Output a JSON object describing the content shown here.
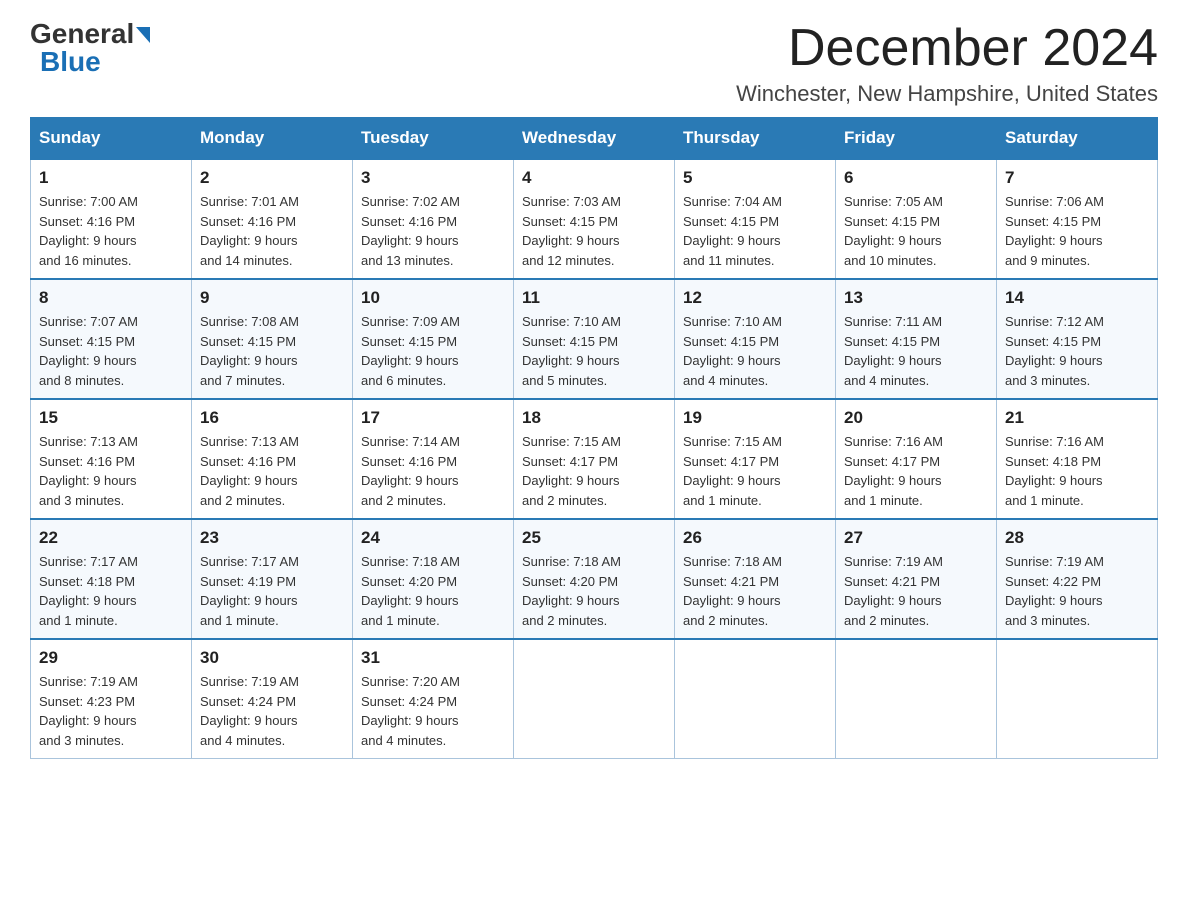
{
  "header": {
    "logo_general": "General",
    "logo_blue": "Blue",
    "month_title": "December 2024",
    "location": "Winchester, New Hampshire, United States"
  },
  "days_of_week": [
    "Sunday",
    "Monday",
    "Tuesday",
    "Wednesday",
    "Thursday",
    "Friday",
    "Saturday"
  ],
  "weeks": [
    [
      {
        "day": "1",
        "sunrise": "7:00 AM",
        "sunset": "4:16 PM",
        "daylight": "9 hours and 16 minutes."
      },
      {
        "day": "2",
        "sunrise": "7:01 AM",
        "sunset": "4:16 PM",
        "daylight": "9 hours and 14 minutes."
      },
      {
        "day": "3",
        "sunrise": "7:02 AM",
        "sunset": "4:16 PM",
        "daylight": "9 hours and 13 minutes."
      },
      {
        "day": "4",
        "sunrise": "7:03 AM",
        "sunset": "4:15 PM",
        "daylight": "9 hours and 12 minutes."
      },
      {
        "day": "5",
        "sunrise": "7:04 AM",
        "sunset": "4:15 PM",
        "daylight": "9 hours and 11 minutes."
      },
      {
        "day": "6",
        "sunrise": "7:05 AM",
        "sunset": "4:15 PM",
        "daylight": "9 hours and 10 minutes."
      },
      {
        "day": "7",
        "sunrise": "7:06 AM",
        "sunset": "4:15 PM",
        "daylight": "9 hours and 9 minutes."
      }
    ],
    [
      {
        "day": "8",
        "sunrise": "7:07 AM",
        "sunset": "4:15 PM",
        "daylight": "9 hours and 8 minutes."
      },
      {
        "day": "9",
        "sunrise": "7:08 AM",
        "sunset": "4:15 PM",
        "daylight": "9 hours and 7 minutes."
      },
      {
        "day": "10",
        "sunrise": "7:09 AM",
        "sunset": "4:15 PM",
        "daylight": "9 hours and 6 minutes."
      },
      {
        "day": "11",
        "sunrise": "7:10 AM",
        "sunset": "4:15 PM",
        "daylight": "9 hours and 5 minutes."
      },
      {
        "day": "12",
        "sunrise": "7:10 AM",
        "sunset": "4:15 PM",
        "daylight": "9 hours and 4 minutes."
      },
      {
        "day": "13",
        "sunrise": "7:11 AM",
        "sunset": "4:15 PM",
        "daylight": "9 hours and 4 minutes."
      },
      {
        "day": "14",
        "sunrise": "7:12 AM",
        "sunset": "4:15 PM",
        "daylight": "9 hours and 3 minutes."
      }
    ],
    [
      {
        "day": "15",
        "sunrise": "7:13 AM",
        "sunset": "4:16 PM",
        "daylight": "9 hours and 3 minutes."
      },
      {
        "day": "16",
        "sunrise": "7:13 AM",
        "sunset": "4:16 PM",
        "daylight": "9 hours and 2 minutes."
      },
      {
        "day": "17",
        "sunrise": "7:14 AM",
        "sunset": "4:16 PM",
        "daylight": "9 hours and 2 minutes."
      },
      {
        "day": "18",
        "sunrise": "7:15 AM",
        "sunset": "4:17 PM",
        "daylight": "9 hours and 2 minutes."
      },
      {
        "day": "19",
        "sunrise": "7:15 AM",
        "sunset": "4:17 PM",
        "daylight": "9 hours and 1 minute."
      },
      {
        "day": "20",
        "sunrise": "7:16 AM",
        "sunset": "4:17 PM",
        "daylight": "9 hours and 1 minute."
      },
      {
        "day": "21",
        "sunrise": "7:16 AM",
        "sunset": "4:18 PM",
        "daylight": "9 hours and 1 minute."
      }
    ],
    [
      {
        "day": "22",
        "sunrise": "7:17 AM",
        "sunset": "4:18 PM",
        "daylight": "9 hours and 1 minute."
      },
      {
        "day": "23",
        "sunrise": "7:17 AM",
        "sunset": "4:19 PM",
        "daylight": "9 hours and 1 minute."
      },
      {
        "day": "24",
        "sunrise": "7:18 AM",
        "sunset": "4:20 PM",
        "daylight": "9 hours and 1 minute."
      },
      {
        "day": "25",
        "sunrise": "7:18 AM",
        "sunset": "4:20 PM",
        "daylight": "9 hours and 2 minutes."
      },
      {
        "day": "26",
        "sunrise": "7:18 AM",
        "sunset": "4:21 PM",
        "daylight": "9 hours and 2 minutes."
      },
      {
        "day": "27",
        "sunrise": "7:19 AM",
        "sunset": "4:21 PM",
        "daylight": "9 hours and 2 minutes."
      },
      {
        "day": "28",
        "sunrise": "7:19 AM",
        "sunset": "4:22 PM",
        "daylight": "9 hours and 3 minutes."
      }
    ],
    [
      {
        "day": "29",
        "sunrise": "7:19 AM",
        "sunset": "4:23 PM",
        "daylight": "9 hours and 3 minutes."
      },
      {
        "day": "30",
        "sunrise": "7:19 AM",
        "sunset": "4:24 PM",
        "daylight": "9 hours and 4 minutes."
      },
      {
        "day": "31",
        "sunrise": "7:20 AM",
        "sunset": "4:24 PM",
        "daylight": "9 hours and 4 minutes."
      },
      null,
      null,
      null,
      null
    ]
  ],
  "labels": {
    "sunrise": "Sunrise:",
    "sunset": "Sunset:",
    "daylight": "Daylight:"
  }
}
